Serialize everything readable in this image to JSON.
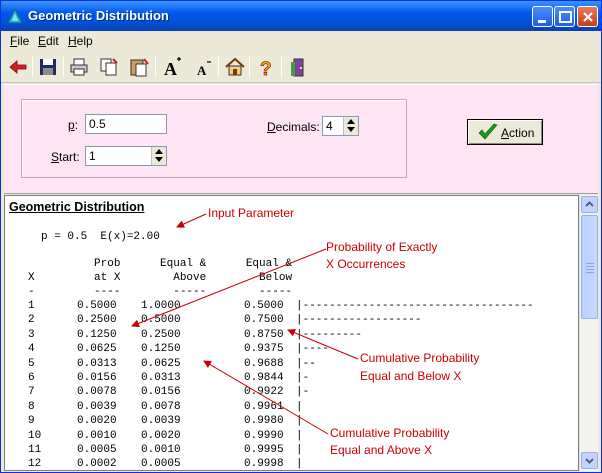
{
  "window": {
    "title": "Geometric Distribution"
  },
  "menu": {
    "file": "File",
    "file_key": "F",
    "file_rest": "ile",
    "edit_key": "E",
    "edit_rest": "dit",
    "help_key": "H",
    "help_rest": "elp"
  },
  "form": {
    "p_label_key": "p",
    "p_label_rest": ":",
    "p_value": "0.5",
    "start_label_key": "S",
    "start_label_rest": "tart:",
    "start_value": "1",
    "decimals_label_key": "D",
    "decimals_label_rest": "ecimals:",
    "decimals_value": "4",
    "action_key": "A",
    "action_rest": "ction"
  },
  "output": {
    "title": "Geometric Distribution",
    "param_line": "p = 0.5  E(x)=2.00",
    "header1": "          Prob      Equal &      Equal &",
    "header2": "X         at X        Above        Below",
    "header3": "-         ----        -----        -----",
    "rows": [
      {
        "x": "1",
        "prob": "0.5000",
        "above": "1.0000",
        "below": "0.5000",
        "bar": "|-----------------------------------"
      },
      {
        "x": "2",
        "prob": "0.2500",
        "above": "0.5000",
        "below": "0.7500",
        "bar": "|------------------"
      },
      {
        "x": "3",
        "prob": "0.1250",
        "above": "0.2500",
        "below": "0.8750",
        "bar": "|---------"
      },
      {
        "x": "4",
        "prob": "0.0625",
        "above": "0.1250",
        "below": "0.9375",
        "bar": "|----"
      },
      {
        "x": "5",
        "prob": "0.0313",
        "above": "0.0625",
        "below": "0.9688",
        "bar": "|--"
      },
      {
        "x": "6",
        "prob": "0.0156",
        "above": "0.0313",
        "below": "0.9844",
        "bar": "|-"
      },
      {
        "x": "7",
        "prob": "0.0078",
        "above": "0.0156",
        "below": "0.9922",
        "bar": "|-"
      },
      {
        "x": "8",
        "prob": "0.0039",
        "above": "0.0078",
        "below": "0.9961",
        "bar": "|"
      },
      {
        "x": "9",
        "prob": "0.0020",
        "above": "0.0039",
        "below": "0.9980",
        "bar": "|"
      },
      {
        "x": "10",
        "prob": "0.0010",
        "above": "0.0020",
        "below": "0.9990",
        "bar": "|"
      },
      {
        "x": "11",
        "prob": "0.0005",
        "above": "0.0010",
        "below": "0.9995",
        "bar": "|"
      },
      {
        "x": "12",
        "prob": "0.0002",
        "above": "0.0005",
        "below": "0.9998",
        "bar": "|"
      }
    ]
  },
  "annotations": {
    "input_parameter": "Input Parameter",
    "prob_exact_1": "Probability of Exactly",
    "prob_exact_2": "X Occurrences",
    "cum_below_1": "Cumulative  Probability",
    "cum_below_2": "Equal and Below X",
    "cum_above_1": "Cumulative  Probability",
    "cum_above_2": "Equal and Above  X"
  },
  "colors": {
    "title_bar": "#0058ee",
    "panel_bg": "#ffe4f4",
    "annotation": "#cc0000",
    "action_check": "#1a9a1a"
  }
}
